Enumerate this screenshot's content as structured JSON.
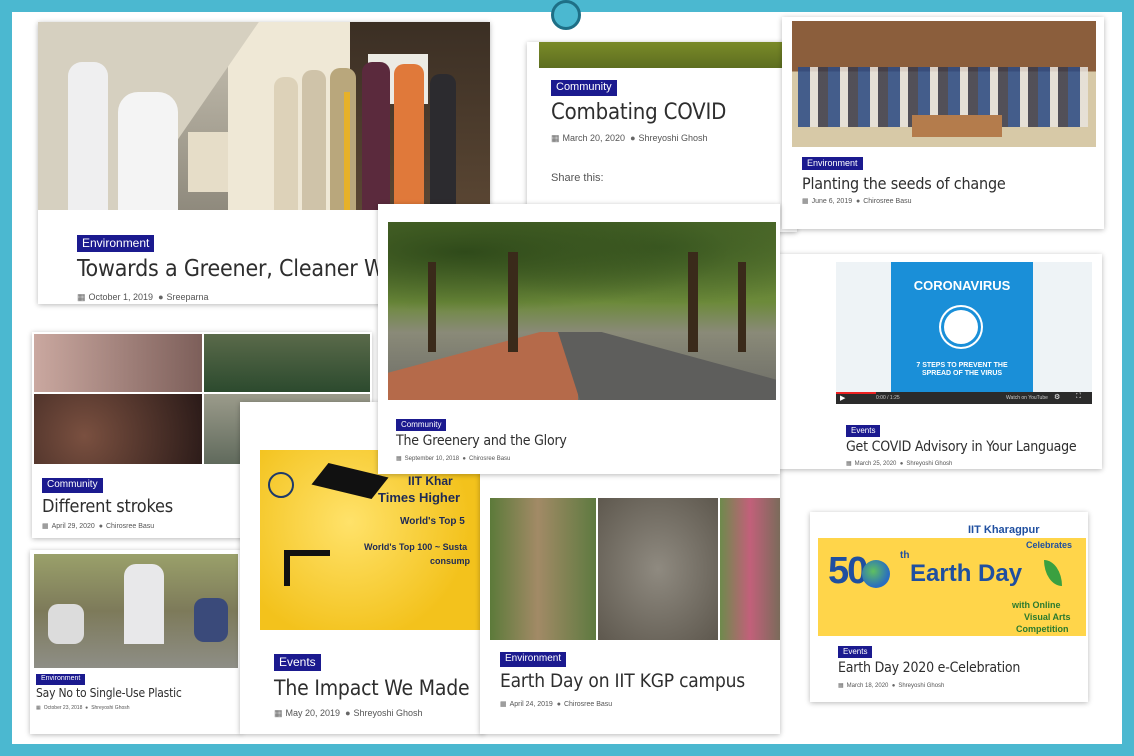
{
  "posts": [
    {
      "category": "Environment",
      "title": "Towards a Greener, Cleaner World",
      "date": "October 1, 2019",
      "author": "Sreeparna"
    },
    {
      "category": "Community",
      "title": "Combating COVID",
      "date": "March 20, 2020",
      "author": "Shreyoshi Ghosh",
      "share": "Share this:"
    },
    {
      "category": "Environment",
      "title": "Planting the seeds of change",
      "date": "June 6, 2019",
      "author": "Chirosree Basu"
    },
    {
      "category": "Community",
      "title": "The Greenery and the Glory",
      "date": "September 10, 2018",
      "author": "Chirosree Basu"
    },
    {
      "category": "Events",
      "title": "Get COVID Advisory in Your Language",
      "date": "March 25, 2020",
      "author": "Shreyoshi Ghosh"
    },
    {
      "category": "Community",
      "title": "Different strokes",
      "date": "April 29, 2020",
      "author": "Chirosree Basu"
    },
    {
      "category": "Environment",
      "title": "Say No to Single-Use Plastic",
      "date": "October 23, 2018",
      "author": "Shreyoshi Ghosh"
    },
    {
      "category": "Events",
      "title": "The Impact We Made",
      "date": "May 20, 2019",
      "author": "Shreyoshi Ghosh"
    },
    {
      "category": "Environment",
      "title": "Earth Day on IIT KGP campus",
      "date": "April 24, 2019",
      "author": "Chirosree Basu"
    },
    {
      "category": "Events",
      "title": "Earth Day 2020 e-Celebration",
      "date": "March 18, 2020",
      "author": "Shreyoshi Ghosh"
    }
  ],
  "covid_video": {
    "heading": "CORONAVIRUS",
    "subheading": "7 STEPS TO PREVENT THE SPREAD OF THE VIRUS",
    "time": "0:00 / 1:25",
    "channel": "Watch on YouTube"
  },
  "impact_poster": {
    "line1": "IIT Khar",
    "line2": "Times Higher",
    "line3": "World's Top 5",
    "line4": "World's Top 100 ~ Susta",
    "line5": "consump"
  },
  "earthday_poster": {
    "line1": "IIT Kharagpur",
    "line2": "Celebrates",
    "number": "50",
    "ordinal": "th",
    "main": "Earth Day",
    "sub1": "with Online",
    "sub2": "Visual Arts",
    "sub3": "Competition"
  },
  "colors": {
    "background": "#4bb8d0",
    "badge": "#1b1a8f",
    "title": "#2e2e2e"
  },
  "icons": {
    "date": "calendar-icon",
    "author": "user-icon"
  }
}
